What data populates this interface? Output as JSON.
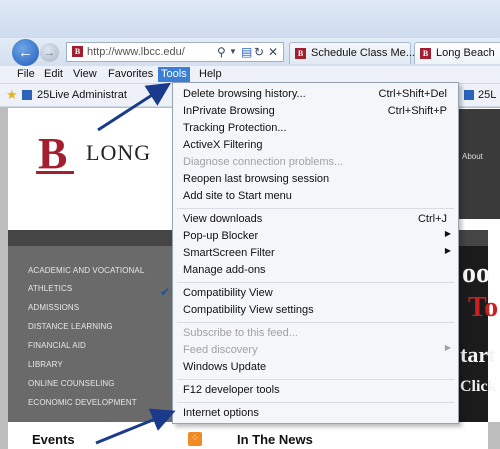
{
  "nav": {
    "url": "http://www.lbcc.edu/",
    "tabs": [
      {
        "label": "Schedule Class Me..."
      },
      {
        "label": "Long Beach"
      }
    ]
  },
  "menubar": {
    "items": [
      "File",
      "Edit",
      "View",
      "Favorites",
      "Tools",
      "Help"
    ]
  },
  "favorites": {
    "items": [
      "25Live Administrat",
      "25L"
    ]
  },
  "page": {
    "logo_text": "LONG",
    "about": "About",
    "side_menu": [
      "ACADEMIC AND VOCATIONAL",
      "ATHLETICS",
      "ADMISSIONS",
      "DISTANCE LEARNING",
      "FINANCIAL AID",
      "LIBRARY",
      "ONLINE COUNSELING",
      "ECONOMIC DEVELOPMENT"
    ],
    "banner": {
      "line1": "oo",
      "line2": "To",
      "line3": "tart",
      "line4": "Click"
    },
    "events": "Events",
    "news": "In The News"
  },
  "tools_menu": {
    "items": [
      {
        "label": "Delete browsing history...",
        "shortcut": "Ctrl+Shift+Del"
      },
      {
        "label": "InPrivate Browsing",
        "shortcut": "Ctrl+Shift+P"
      },
      {
        "label": "Tracking Protection..."
      },
      {
        "label": "ActiveX Filtering"
      },
      {
        "label": "Diagnose connection problems...",
        "disabled": true
      },
      {
        "label": "Reopen last browsing session"
      },
      {
        "label": "Add site to Start menu"
      },
      {
        "label": "View downloads",
        "shortcut": "Ctrl+J"
      },
      {
        "label": "Pop-up Blocker",
        "submenu": true
      },
      {
        "label": "SmartScreen Filter",
        "submenu": true
      },
      {
        "label": "Manage add-ons"
      },
      {
        "label": "Compatibility View",
        "checked": true
      },
      {
        "label": "Compatibility View settings"
      },
      {
        "label": "Subscribe to this feed...",
        "disabled": true
      },
      {
        "label": "Feed discovery",
        "disabled": true,
        "submenu": true
      },
      {
        "label": "Windows Update"
      },
      {
        "label": "F12 developer tools"
      },
      {
        "label": "Internet options"
      }
    ]
  },
  "colors": {
    "accent": "#3b7fd4",
    "highlight": "#f2f542",
    "arrow": "#1a3a8c",
    "logo": "#a31f2f"
  }
}
